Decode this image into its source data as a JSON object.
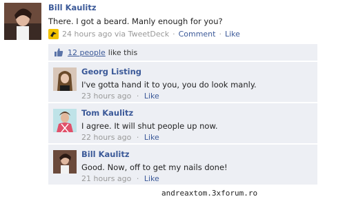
{
  "post": {
    "author": "Bill Kaulitz",
    "text": "There. I got a beard. Manly enough for you?",
    "time": "24 hours ago via TweetDeck",
    "comment_link": "Comment",
    "like_link": "Like",
    "separator": "·"
  },
  "likes": {
    "count_text": "12 people",
    "suffix": "like this"
  },
  "comments": [
    {
      "author": "Georg Listing",
      "text": "I've gotta hand it to you, you do look manly.",
      "time": "23 hours ago",
      "like": "Like",
      "sep": "·"
    },
    {
      "author": "Tom Kaulitz",
      "text": "I agree. It will shut people up now.",
      "time": "22 hours ago",
      "like": "Like",
      "sep": "·"
    },
    {
      "author": "Bill Kaulitz",
      "text": "Good. Now, off to get my nails done!",
      "time": "21 hours ago",
      "like": "Like",
      "sep": "·"
    }
  ],
  "watermark": "andreaxtom.3xforum.ro",
  "colors": {
    "link": "#3b5998",
    "panel": "#edeff4",
    "muted": "#999999"
  }
}
